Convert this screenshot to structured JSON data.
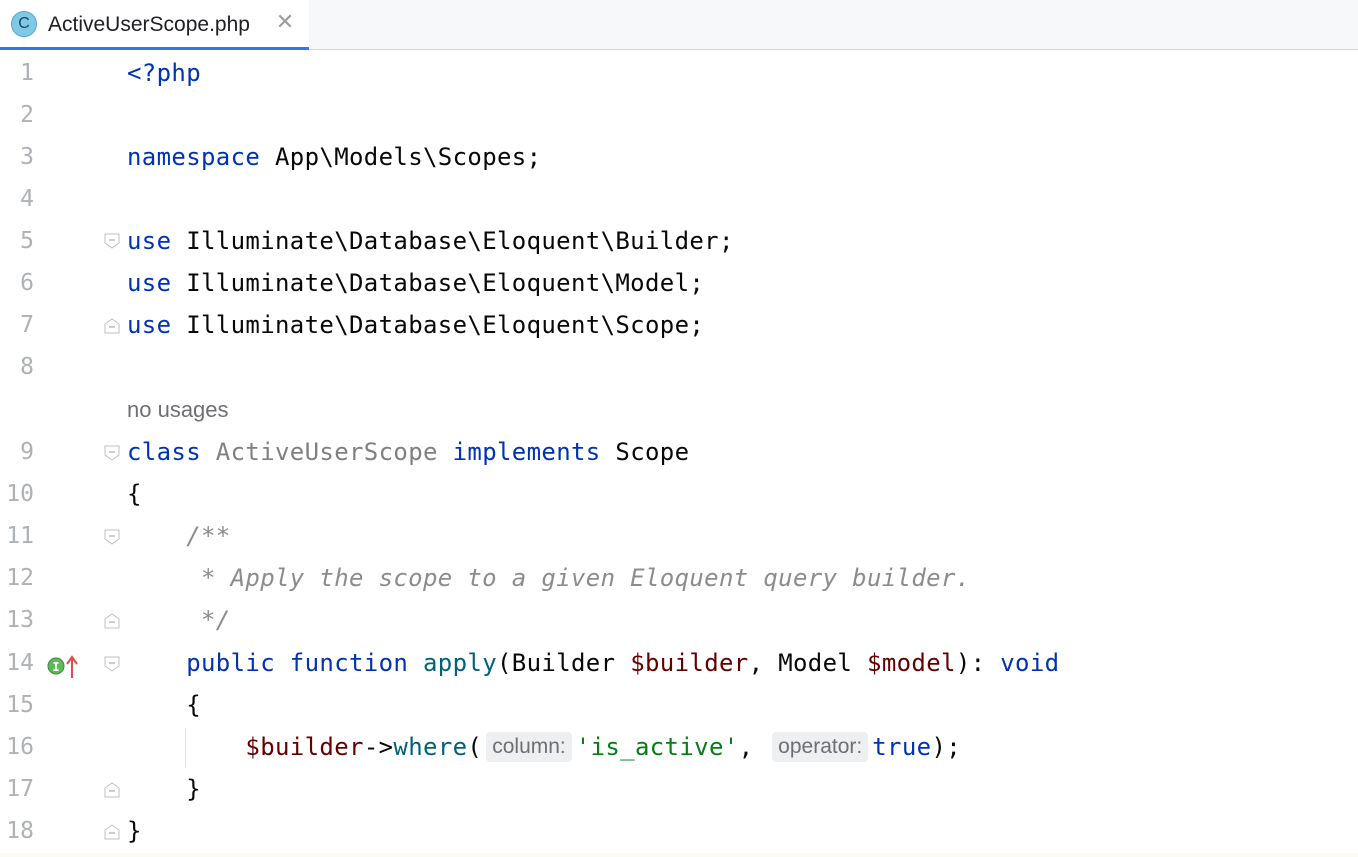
{
  "tab": {
    "icon_letter": "C",
    "file_name": "ActiveUserScope.php",
    "close_glyph": "✕",
    "accent_color": "#3574f0"
  },
  "gutter": {
    "line_numbers": [
      "1",
      "2",
      "3",
      "4",
      "5",
      "6",
      "7",
      "8",
      "9",
      "10",
      "11",
      "12",
      "13",
      "14",
      "15",
      "16",
      "17",
      "18"
    ],
    "marker_icons": [
      "implementing-method-icon",
      "navigate-up-arrow-icon"
    ],
    "marker_letter": "I"
  },
  "code": {
    "line1": "<?php",
    "line3_kw": "namespace",
    "line3_rest": " App\\Models\\Scopes;",
    "use_kw": "use",
    "line5_rest": " Illuminate\\Database\\Eloquent\\Builder;",
    "line6_rest": " Illuminate\\Database\\Eloquent\\Model;",
    "line7_rest": " Illuminate\\Database\\Eloquent\\Scope;",
    "usages_hint": "no usages",
    "line9_class": "class",
    "line9_name": " ActiveUserScope ",
    "line9_implements": "implements",
    "line9_scope": " Scope",
    "line10": "{",
    "line11": "    /**",
    "line12": "     * Apply the scope to a given Eloquent query builder.",
    "line13": "     */",
    "line14_indent": "    ",
    "line14_public": "public",
    "line14_function": " function ",
    "line14_name": "apply",
    "line14_open": "(Builder ",
    "line14_builder": "$builder",
    "line14_mid": ", Model ",
    "line14_model": "$model",
    "line14_close": "): ",
    "line14_void": "void",
    "line15": "    {",
    "line16_indent": "        ",
    "line16_var": "$builder",
    "line16_arrow": "->",
    "line16_method": "where",
    "line16_paren": "(",
    "line16_hint1": "column:",
    "line16_str": "'is_active'",
    "line16_comma": ", ",
    "line16_hint2": "operator:",
    "line16_true": "true",
    "line16_end": ");",
    "line17": "    }",
    "line18": "}"
  },
  "colors": {
    "keyword": "#0033b3",
    "string": "#067d17",
    "variable": "#660000",
    "method": "#00627a",
    "comment": "#8c8c8c"
  }
}
